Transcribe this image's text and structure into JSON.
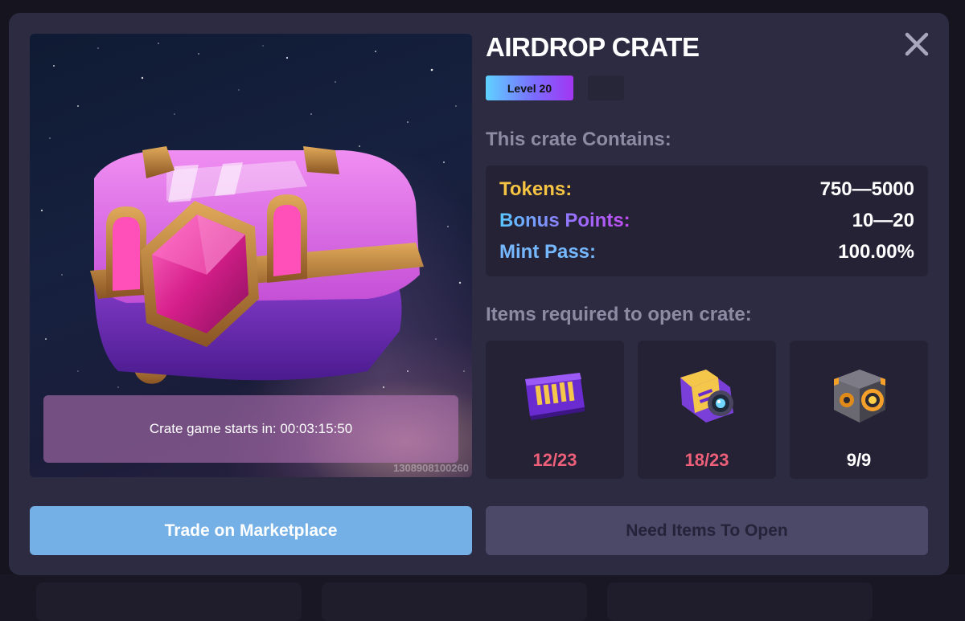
{
  "modal": {
    "title": "AIRDROP CRATE",
    "level_badge": "Level 20",
    "hero": {
      "timer_text": "Crate game starts in: 00:03:15:50",
      "crate_id": "1308908100260"
    },
    "contents": {
      "heading": "This crate Contains:",
      "rows": [
        {
          "label": "Tokens:",
          "value": "750—5000",
          "color": "#f6c443"
        },
        {
          "label": "Bonus Points:",
          "value": "10—20",
          "color": "#9b6cff"
        },
        {
          "label": "Mint Pass:",
          "value": "100.00%",
          "color": "#76b8ff"
        }
      ]
    },
    "required": {
      "heading": "Items required to open crate:",
      "items": [
        {
          "icon": "purple-circuit-plate-icon",
          "count": "12/23",
          "count_color": "#ee5f79"
        },
        {
          "icon": "yellow-lens-module-icon",
          "count": "18/23",
          "count_color": "#ee5f79"
        },
        {
          "icon": "metal-core-cube-icon",
          "count": "9/9",
          "count_color": "#ffffff"
        }
      ]
    },
    "buttons": {
      "trade": "Trade on Marketplace",
      "need_items": "Need Items To Open"
    }
  },
  "colors": {
    "modal_bg": "#2d2b42",
    "trade_button": "#74b0e6",
    "need_button": "#4c4868"
  }
}
